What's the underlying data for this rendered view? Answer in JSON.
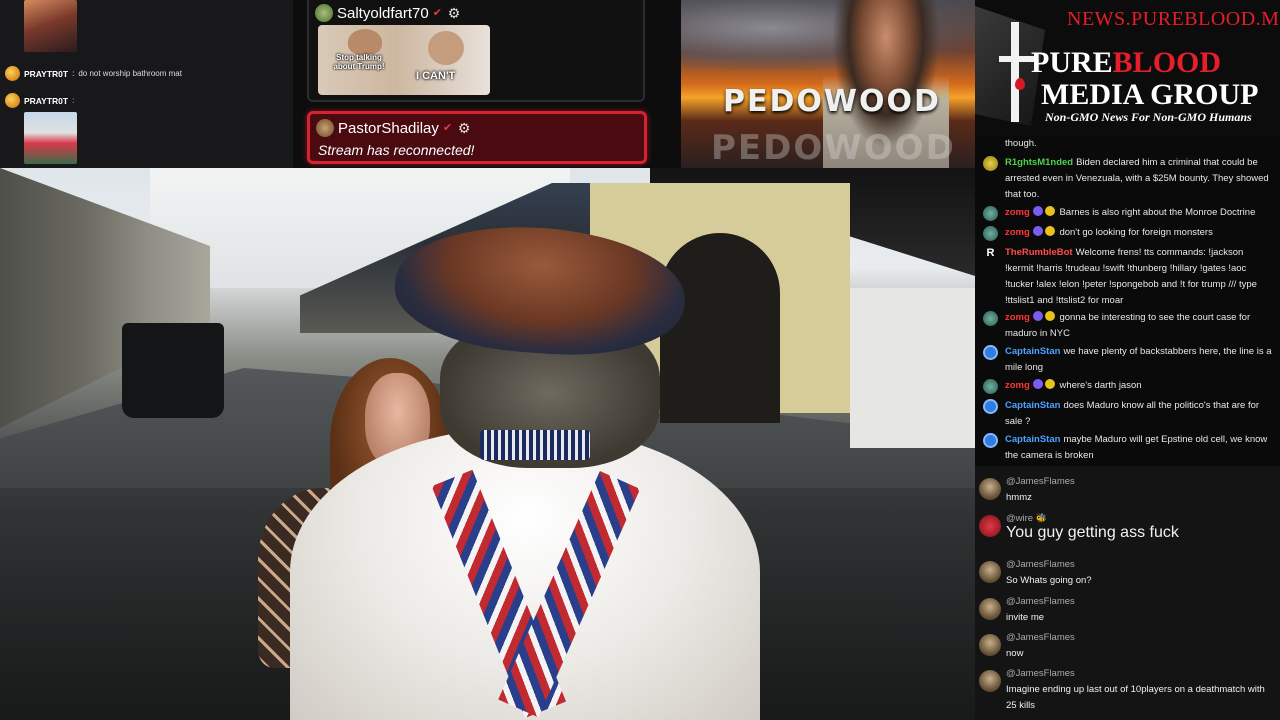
{
  "top_left_chat": {
    "messages": [
      {
        "user": "PRAYTR0T",
        "text": "do not worship bathroom mat"
      },
      {
        "user": "PRAYTR0T",
        "text": ":"
      }
    ]
  },
  "alerts": {
    "alert1": {
      "user": "Saltyoldfart70",
      "meme_caption1": "Stop talking about Trump!",
      "meme_caption2": "I CAN'T"
    },
    "alert2": {
      "user": "PastorShadilay",
      "system_text": "Stream has reconnected!"
    }
  },
  "banner": {
    "word1": "PEDOWOOD",
    "word2": "PEDOWOOD"
  },
  "logo": {
    "url": "NEWS.PUREBLOOD.MEDIA",
    "line1_pre": "P",
    "line1_mid": "URE",
    "line1_red": "BLOOD",
    "line2": "MEDIA GROUP",
    "tagline": "Non-GMO News For Non-GMO Humans"
  },
  "rumble_chat": [
    {
      "user": "",
      "text": "though."
    },
    {
      "user": "R1ghtsM1nded",
      "text": "Biden declared him a criminal that could be arrested even in Venezuala, with a $25M bounty. They showed that too."
    },
    {
      "user": "zomg",
      "text": "Barnes is also right about the Monroe Doctrine"
    },
    {
      "user": "zomg",
      "text": "don't go looking for foreign monsters"
    },
    {
      "user": "TheRumbleBot",
      "text": "Welcome frens! tts commands: !jackson !kermit !harris !trudeau !swift !thunberg !hillary !gates !aoc !tucker !alex !elon !peter !spongebob and !t for trump /// type !ttslist1 and !ttslist2 for moar"
    },
    {
      "user": "zomg",
      "text": "gonna be interesting to see the court case for maduro in NYC"
    },
    {
      "user": "CaptainStan",
      "text": "we have plenty of backstabbers here, the line is a mile long"
    },
    {
      "user": "zomg",
      "text": "where's darth jason"
    },
    {
      "user": "CaptainStan",
      "text": "does Maduro know all the politico's that are for sale ?"
    },
    {
      "user": "CaptainStan",
      "text": "maybe Maduro will get Epstine old cell, we know the camera is broken"
    }
  ],
  "youtube_chat": [
    {
      "user": "@JamesFlames",
      "text": "hmmz"
    },
    {
      "user": "@wire",
      "text": "You guy getting ass fuck"
    },
    {
      "user": "@JamesFlames",
      "text": "So Whats going on?"
    },
    {
      "user": "@JamesFlames",
      "text": "invite me"
    },
    {
      "user": "@JamesFlames",
      "text": "now"
    },
    {
      "user": "@JamesFlames",
      "text": "Imagine ending up last out of 10players on a deathmatch with 25 kills"
    }
  ],
  "colors": {
    "accent_red": "#d52331",
    "rumble_green": "#4fd14f",
    "rumble_red": "#ff3535",
    "rumble_blue": "#4aa3ff"
  }
}
